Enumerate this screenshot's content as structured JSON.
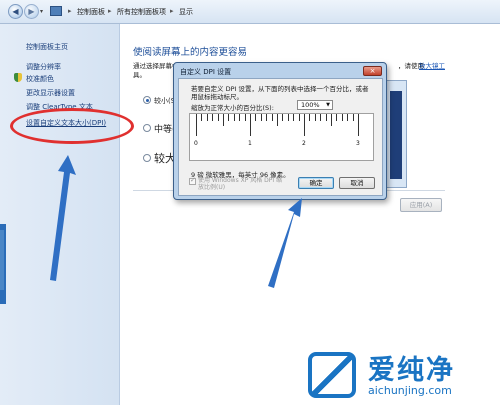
{
  "address_bar": {
    "crumbs": [
      "控制面板",
      "所有控制面板项",
      "显示"
    ]
  },
  "left_nav": {
    "items": [
      "控制面板主页",
      "调整分辨率",
      "校准颜色",
      "更改显示器设置",
      "调整 ClearType 文本",
      "设置自定义文本大小(DPI)"
    ]
  },
  "main": {
    "heading": "使阅读屏幕上的内容更容易",
    "description_line1": "通过选择屏幕中",
    "description_tail": "，请使用",
    "description_link": "放大镜工",
    "description_line2": "具。",
    "options": [
      {
        "label": "较小(S)",
        "selected": true
      },
      {
        "label": "中等(M)",
        "selected": false
      },
      {
        "label": "较大",
        "selected": false
      }
    ],
    "apply_label": "应用(A)"
  },
  "dialog": {
    "title": "自定义 DPI 设置",
    "close_label": "×",
    "instruction": "若要自定义 DPI 设置，从下面的列表中选择一个百分比，或者用鼠标拖动标尺。",
    "scale_label": "缩放为正常大小的百分比(S):",
    "scale_value": "100%",
    "ruler_labels": [
      "0",
      "1",
      "2",
      "3"
    ],
    "pixel_text": "9 磅 微软雅黑，每英寸 96 像素。",
    "xp_checkbox_label": "使用 Windows XP 风格 DPI 缩放比例(U)",
    "xp_checked": true,
    "ok_label": "确定",
    "cancel_label": "取消"
  },
  "watermark": {
    "brand_cn": "爱纯净",
    "url": "aichunjing.com"
  },
  "colors": {
    "annotation": "#e0302f",
    "arrow": "#2f6fc4",
    "link": "#1a56b5",
    "heading": "#1e4f99"
  }
}
